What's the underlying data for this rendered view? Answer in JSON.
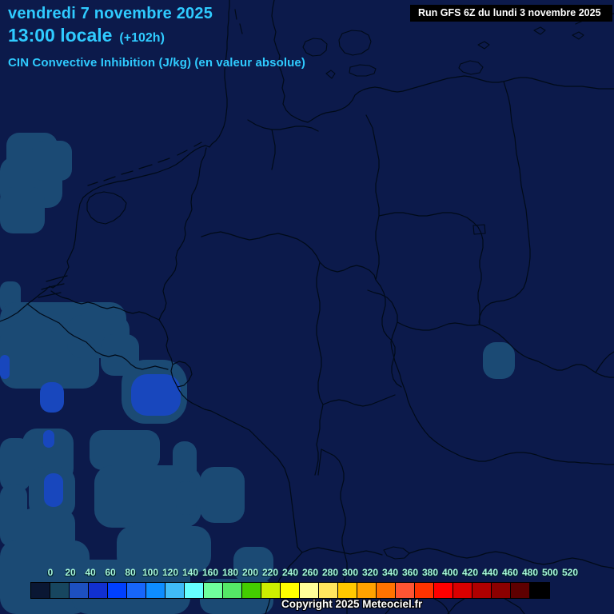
{
  "header": {
    "date_line": "vendredi 7 novembre 2025",
    "time_line": "13:00 locale",
    "forecast_offset": "(+102h)",
    "subtitle": "CIN Convective Inhibition (J/kg) (en valeur absolue)",
    "run_info": "Run GFS 6Z du lundi 3 novembre 2025"
  },
  "footer": {
    "copyright": "Copyright 2025 Meteociel.fr"
  },
  "colorscale": {
    "unit": "J/kg",
    "tick_labels": [
      "0",
      "20",
      "40",
      "60",
      "80",
      "100",
      "120",
      "140",
      "160",
      "180",
      "200",
      "220",
      "240",
      "260",
      "280",
      "300",
      "320",
      "340",
      "360",
      "380",
      "400",
      "420",
      "440",
      "460",
      "480",
      "500",
      "520"
    ],
    "cell_colors": [
      "#0A1733",
      "#17465F",
      "#1D50C0",
      "#1130D0",
      "#0040FF",
      "#1766FA",
      "#0E8DFF",
      "#40BBF7",
      "#66FFFF",
      "#6FFF9C",
      "#55E866",
      "#44CC00",
      "#CCEE00",
      "#FFFF00",
      "#FFFF99",
      "#FFE55E",
      "#FFC800",
      "#FFA200",
      "#FF7300",
      "#FF5533",
      "#FF3300",
      "#FF0000",
      "#D90000",
      "#B00000",
      "#8C0000",
      "#5E0000",
      "#000000"
    ]
  },
  "map": {
    "background_color": "#0C1A4B",
    "border_color": "#000A18",
    "shaded_levels": [
      {
        "label": "cin-low",
        "color": "#1B4A74"
      },
      {
        "label": "cin-moderate",
        "color": "#1847BD"
      }
    ],
    "text_colors": {
      "accent": "#2FCBFF",
      "scale_labels": "#A6F7D9"
    }
  }
}
